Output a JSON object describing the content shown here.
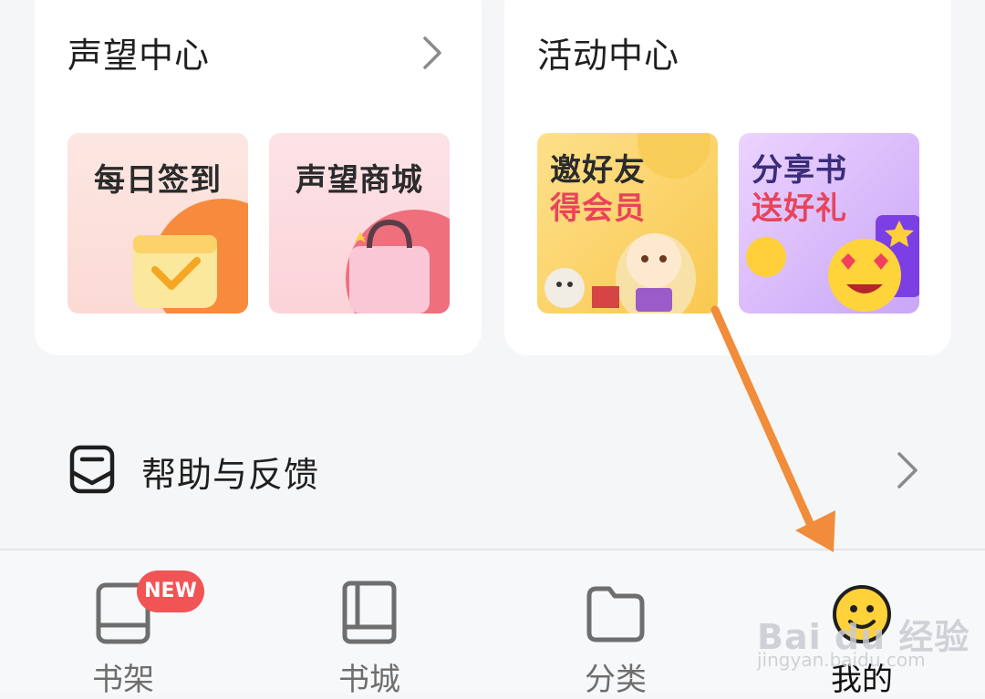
{
  "reputation_card": {
    "title": "声望中心",
    "tiles": [
      {
        "label": "每日签到"
      },
      {
        "label": "声望商城"
      }
    ]
  },
  "activity_card": {
    "title": "活动中心",
    "tiles": [
      {
        "line1": "邀好友",
        "line2": "得会员"
      },
      {
        "line1": "分享书",
        "line2": "送好礼"
      }
    ]
  },
  "help_row": {
    "label": "帮助与反馈"
  },
  "tabbar": {
    "tabs": [
      {
        "label": "书架",
        "badge": "NEW"
      },
      {
        "label": "书城"
      },
      {
        "label": "分类"
      },
      {
        "label": "我的"
      }
    ]
  },
  "watermark": {
    "text": "Bai du 经验",
    "sub": "jingyan.baidu.com"
  },
  "colors": {
    "accent_orange": "#f08c3a",
    "badge_red": "#f15454",
    "background": "#f5f6f8"
  }
}
